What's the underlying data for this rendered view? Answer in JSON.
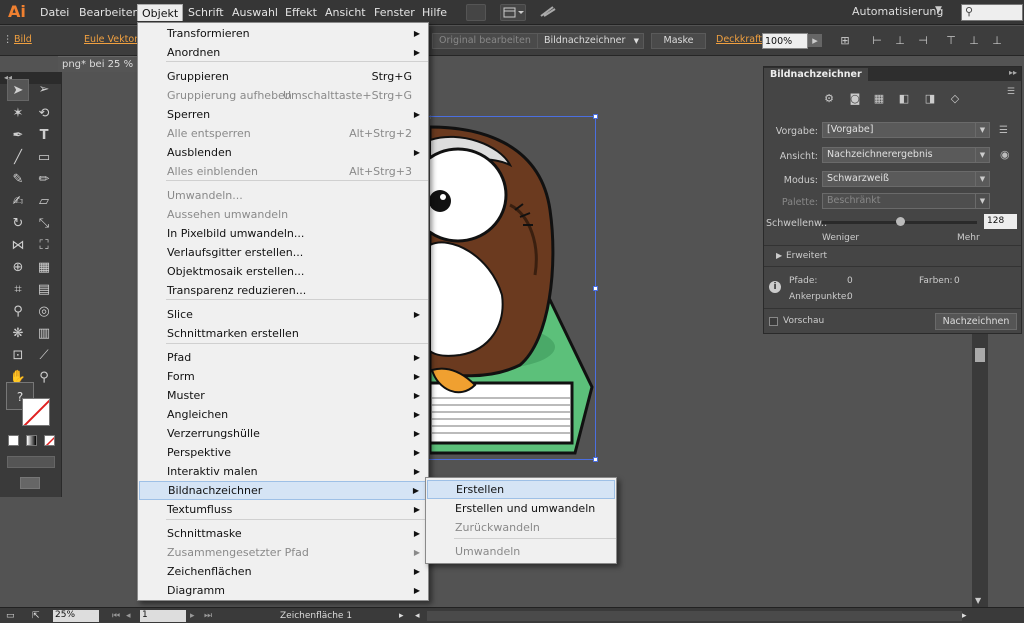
{
  "app": {
    "logo": "Ai",
    "workspace": "Automatisierung",
    "search_icon": "search-icon"
  },
  "menubar": {
    "items": [
      "Datei",
      "Bearbeiten",
      "Objekt",
      "Schrift",
      "Auswahl",
      "Effekt",
      "Ansicht",
      "Fenster",
      "Hilfe"
    ],
    "active": "Objekt"
  },
  "controlbar": {
    "type_label": "Bild",
    "file_link": "Eule Vektor.p",
    "edit_original": "Original bearbeiten",
    "trace_button": "Bildnachzeichner",
    "mask_button": "Maske",
    "opacity_label": "Deckkraft:",
    "opacity_value": "100%"
  },
  "document": {
    "tab_title": "png* bei 25 % (R"
  },
  "objekt_menu": {
    "items": [
      {
        "label": "Transformieren",
        "shortcut": "",
        "submenu": true,
        "disabled": false
      },
      {
        "label": "Anordnen",
        "shortcut": "",
        "submenu": true,
        "disabled": false
      },
      {
        "label": "Gruppieren",
        "shortcut": "Strg+G",
        "submenu": false,
        "disabled": false
      },
      {
        "label": "Gruppierung aufheben",
        "shortcut": "Umschalttaste+Strg+G",
        "submenu": false,
        "disabled": true
      },
      {
        "label": "Sperren",
        "shortcut": "",
        "submenu": true,
        "disabled": false
      },
      {
        "label": "Alle entsperren",
        "shortcut": "Alt+Strg+2",
        "submenu": false,
        "disabled": true
      },
      {
        "label": "Ausblenden",
        "shortcut": "",
        "submenu": true,
        "disabled": false
      },
      {
        "label": "Alles einblenden",
        "shortcut": "Alt+Strg+3",
        "submenu": false,
        "disabled": true
      },
      {
        "label": "Umwandeln...",
        "shortcut": "",
        "submenu": false,
        "disabled": true
      },
      {
        "label": "Aussehen umwandeln",
        "shortcut": "",
        "submenu": false,
        "disabled": true
      },
      {
        "label": "In Pixelbild umwandeln...",
        "shortcut": "",
        "submenu": false,
        "disabled": false
      },
      {
        "label": "Verlaufsgitter erstellen...",
        "shortcut": "",
        "submenu": false,
        "disabled": false
      },
      {
        "label": "Objektmosaik erstellen...",
        "shortcut": "",
        "submenu": false,
        "disabled": false
      },
      {
        "label": "Transparenz reduzieren...",
        "shortcut": "",
        "submenu": false,
        "disabled": false
      },
      {
        "label": "Slice",
        "shortcut": "",
        "submenu": true,
        "disabled": false
      },
      {
        "label": "Schnittmarken erstellen",
        "shortcut": "",
        "submenu": false,
        "disabled": false
      },
      {
        "label": "Pfad",
        "shortcut": "",
        "submenu": true,
        "disabled": false
      },
      {
        "label": "Form",
        "shortcut": "",
        "submenu": true,
        "disabled": false
      },
      {
        "label": "Muster",
        "shortcut": "",
        "submenu": true,
        "disabled": false
      },
      {
        "label": "Angleichen",
        "shortcut": "",
        "submenu": true,
        "disabled": false
      },
      {
        "label": "Verzerrungshülle",
        "shortcut": "",
        "submenu": true,
        "disabled": false
      },
      {
        "label": "Perspektive",
        "shortcut": "",
        "submenu": true,
        "disabled": false
      },
      {
        "label": "Interaktiv malen",
        "shortcut": "",
        "submenu": true,
        "disabled": false
      },
      {
        "label": "Bildnachzeichner",
        "shortcut": "",
        "submenu": true,
        "disabled": false
      },
      {
        "label": "Textumfluss",
        "shortcut": "",
        "submenu": true,
        "disabled": false
      },
      {
        "label": "Schnittmaske",
        "shortcut": "",
        "submenu": true,
        "disabled": false
      },
      {
        "label": "Zusammengesetzter Pfad",
        "shortcut": "",
        "submenu": true,
        "disabled": true
      },
      {
        "label": "Zeichenflächen",
        "shortcut": "",
        "submenu": true,
        "disabled": false
      },
      {
        "label": "Diagramm",
        "shortcut": "",
        "submenu": true,
        "disabled": false
      }
    ]
  },
  "trace_submenu": {
    "items": [
      {
        "label": "Erstellen",
        "disabled": false
      },
      {
        "label": "Erstellen und umwandeln",
        "disabled": false
      },
      {
        "label": "Zurückwandeln",
        "disabled": true
      },
      {
        "label": "Umwandeln",
        "disabled": true
      }
    ]
  },
  "trace_panel": {
    "title": "Bildnachzeichner",
    "vorgabe_label": "Vorgabe:",
    "vorgabe_value": "[Vorgabe]",
    "ansicht_label": "Ansicht:",
    "ansicht_value": "Nachzeichnerergebnis",
    "modus_label": "Modus:",
    "modus_value": "Schwarzweiß",
    "palette_label": "Palette:",
    "palette_value": "Beschränkt",
    "threshold_label": "Schwellenw.:",
    "threshold_value": "128",
    "threshold_level": 0.5,
    "slider_min_label": "Weniger",
    "slider_max_label": "Mehr",
    "advanced_label": "Erweitert",
    "paths_label": "Pfade:",
    "paths_value": "0",
    "colors_label": "Farben:",
    "colors_value": "0",
    "anchors_label": "Ankerpunkte:",
    "anchors_value": "0",
    "preview_label": "Vorschau",
    "trace_button": "Nachzeichnen"
  },
  "statusbar": {
    "zoom": "25%",
    "page": "1",
    "artboard_label": "Zeichenfläche 1"
  },
  "toolbox": {
    "fill_stroke_placeholder": "?"
  },
  "colors": {
    "menu_bg": "#f0f0f0",
    "highlight": "#d5e4f5",
    "accent_orange": "#f08030",
    "owl_brown": "#6b3a1f",
    "book_green": "#5cc07a"
  }
}
